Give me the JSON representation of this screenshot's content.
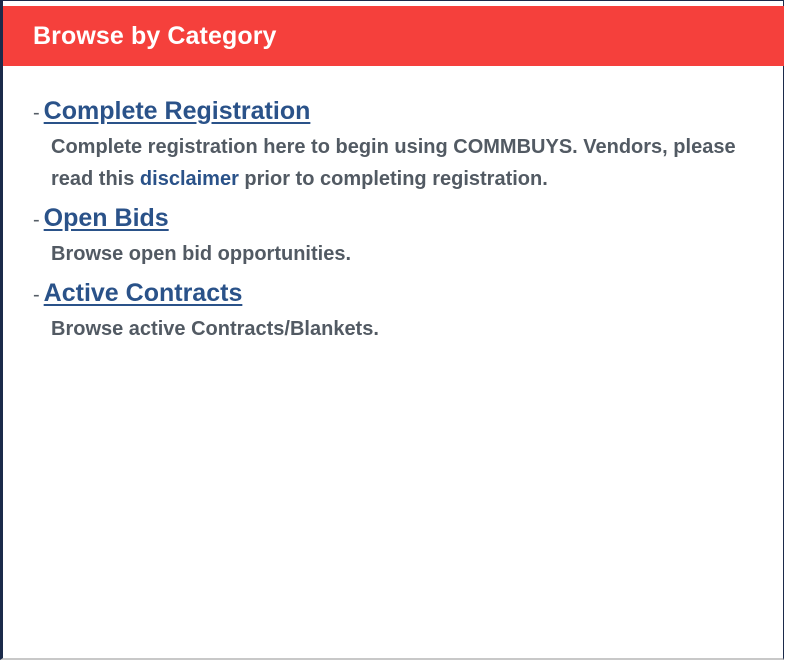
{
  "panel": {
    "title": "Browse by Category"
  },
  "entries": [
    {
      "bullet": "-",
      "link": "Complete Registration",
      "desc_before": "Complete registration here to begin using COMMBUYS. Vendors, please read this ",
      "desc_link": "disclaimer",
      "desc_after": " prior to completing registration."
    },
    {
      "bullet": "-",
      "link": "Open Bids",
      "desc": "Browse open bid opportunities."
    },
    {
      "bullet": "-",
      "link": "Active Contracts",
      "desc": "Browse active Contracts/Blankets."
    }
  ],
  "colors": {
    "header": "#f5403c",
    "link": "#2a5289",
    "text": "#525a63"
  }
}
